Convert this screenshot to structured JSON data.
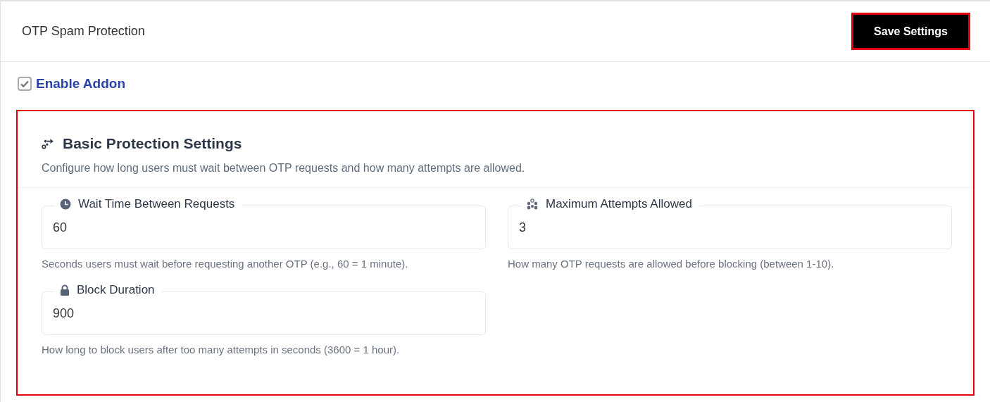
{
  "header": {
    "title": "OTP Spam Protection",
    "save_button": "Save Settings"
  },
  "enable_addon": {
    "label": "Enable Addon",
    "checked": true
  },
  "section": {
    "title": "Basic Protection Settings",
    "description": "Configure how long users must wait between OTP requests and how many attempts are allowed.",
    "fields": [
      {
        "kind": "clock",
        "label": "Wait Time Between Requests",
        "value": "60",
        "help": "Seconds users must wait before requesting another OTP (e.g., 60 = 1 minute)."
      },
      {
        "kind": "group",
        "label": "Maximum Attempts Allowed",
        "value": "3",
        "help": "How many OTP requests are allowed before blocking (between 1-10)."
      },
      {
        "kind": "lock",
        "label": "Block Duration",
        "value": "900",
        "help": "How long to block users after too many attempts in seconds (3600 = 1 hour)."
      }
    ]
  }
}
